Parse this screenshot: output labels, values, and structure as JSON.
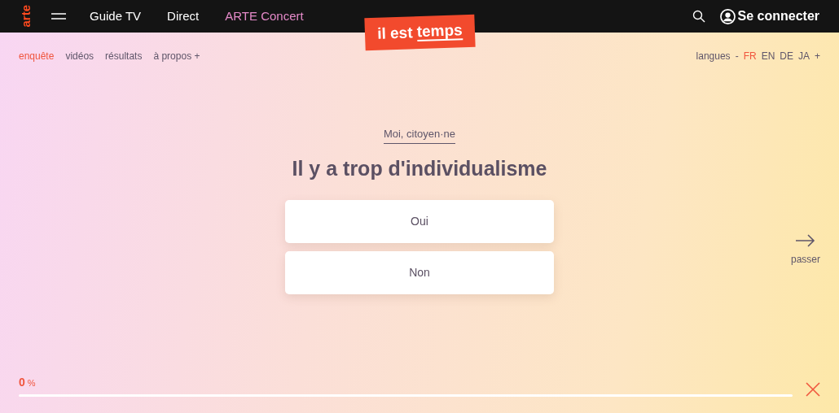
{
  "header": {
    "logo": "arte",
    "nav": [
      {
        "label": "Guide TV",
        "color": "#ffffff"
      },
      {
        "label": "Direct",
        "color": "#ffffff"
      },
      {
        "label": "ARTE Concert",
        "color": "#e58ac9"
      }
    ],
    "login": "Se connecter",
    "badge": {
      "text": "il est ",
      "underlined": "temps"
    }
  },
  "subnav": {
    "items": [
      {
        "label": "enquête",
        "selected": true
      },
      {
        "label": "vidéos",
        "selected": false
      },
      {
        "label": "résultats",
        "selected": false
      },
      {
        "label": "à propos +",
        "selected": false
      }
    ],
    "languages_label": "langues",
    "separator": "-",
    "languages": [
      {
        "label": "FR",
        "selected": true
      },
      {
        "label": "EN",
        "selected": false
      },
      {
        "label": "DE",
        "selected": false
      },
      {
        "label": "JA",
        "selected": false
      }
    ],
    "more": "+"
  },
  "question": {
    "category": "Moi, citoyen·ne",
    "title": "Il y a trop d'individualisme",
    "answers": [
      "Oui",
      "Non"
    ],
    "skip": "passer"
  },
  "progress": {
    "number": "0",
    "unit": "%"
  }
}
